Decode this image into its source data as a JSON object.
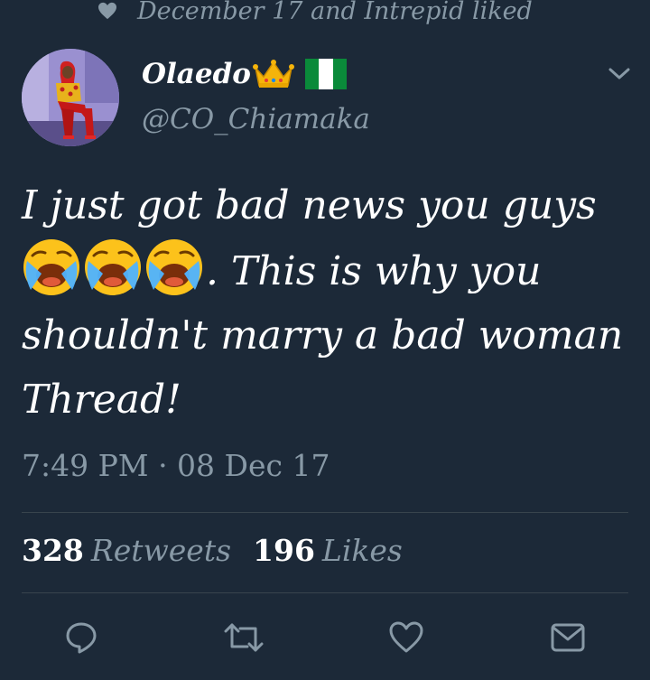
{
  "social_context": "December 17 and Intrepid liked",
  "author": {
    "display_name": "Olaedo",
    "handle": "@CO_Chiamaka"
  },
  "tweet": {
    "text_line_1": "I just got bad news you guys",
    "text_after_emoji": ". This is why you",
    "text_line_3": "shouldn't marry a bad woman",
    "text_line_4": "Thread!"
  },
  "timestamp": "7:49 PM · 08 Dec 17",
  "stats": {
    "retweets_count": "328",
    "retweets_label": "Retweets",
    "likes_count": "196",
    "likes_label": "Likes"
  },
  "icons": [
    "heart-icon",
    "crown-icon",
    "nigeria-flag-icon",
    "chevron-down-icon",
    "loudly-crying-face-icon",
    "reply-icon",
    "retweet-icon",
    "like-icon",
    "direct-message-icon"
  ],
  "colors": {
    "background": "#1c2938",
    "secondary_text": "#8899a6",
    "divider": "#38444d",
    "primary_text": "#ffffff"
  }
}
